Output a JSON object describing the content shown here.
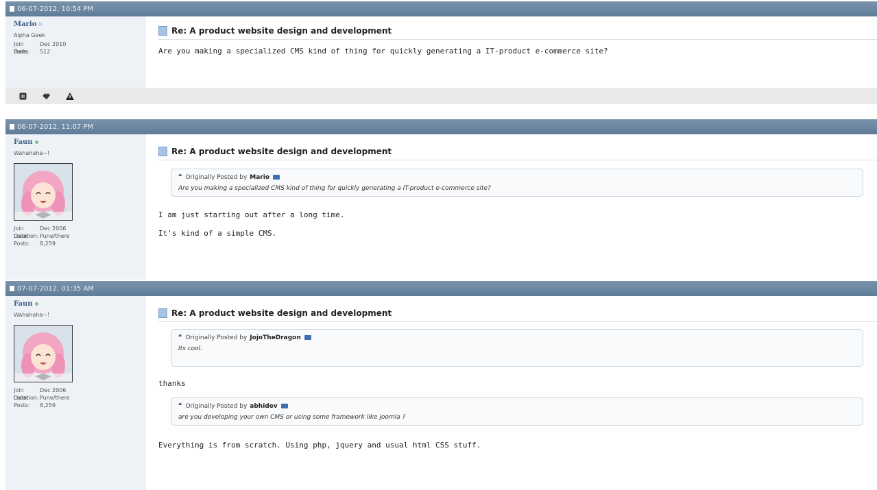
{
  "posts": [
    {
      "date": "06-07-2012, 10:54 PM",
      "username": "Mario",
      "usertitle": "Alpha Geek",
      "stats": [
        {
          "label": "Join Date:",
          "value": "Dec 2010"
        },
        {
          "label": "Posts:",
          "value": "512"
        }
      ],
      "title": "Re: A product website design and development",
      "body": [
        "Are you making a specialized CMS kind of thing for quickly generating a IT-product e-commerce site?"
      ]
    },
    {
      "date": "06-07-2012, 11:07 PM",
      "username": "Faun",
      "usertitle": "Wahahaha~!",
      "stats": [
        {
          "label": "Join Date:",
          "value": "Dec 2006"
        },
        {
          "label": "Location:",
          "value": "Pune/there"
        },
        {
          "label": "Posts:",
          "value": "8,259"
        }
      ],
      "title": "Re: A product website design and development",
      "quote": {
        "prefix": "Originally Posted by",
        "author": "Mario",
        "text": "Are you making a specialized CMS kind of thing for quickly generating a IT-product e-commerce site?"
      },
      "body": [
        "I am just starting out after a long time.",
        "It's kind of a simple CMS."
      ]
    },
    {
      "date": "07-07-2012, 01:35 AM",
      "username": "Faun",
      "usertitle": "Wahahaha~!",
      "stats": [
        {
          "label": "Join Date:",
          "value": "Dec 2006"
        },
        {
          "label": "Location:",
          "value": "Pune/there"
        },
        {
          "label": "Posts:",
          "value": "8,259"
        }
      ],
      "title": "Re: A product website design and development",
      "quote1": {
        "prefix": "Originally Posted by",
        "author": "JojoTheDragon",
        "text": "Its cool."
      },
      "middle": "thanks",
      "quote2": {
        "prefix": "Originally Posted by",
        "author": "abhidev",
        "text": "are you developing your own CMS or using some framework like joomla ?"
      },
      "body": [
        "Everything is from scratch. Using php, jquery and usual html CSS stuff."
      ]
    }
  ],
  "toolbar": {
    "icons": [
      "blog-icon",
      "thanks-icon",
      "report-icon"
    ]
  },
  "colors": {
    "header": "#6f88a2",
    "userpanel": "#eef1f6",
    "username": "#3d5d82",
    "online": "#7cc47c"
  }
}
